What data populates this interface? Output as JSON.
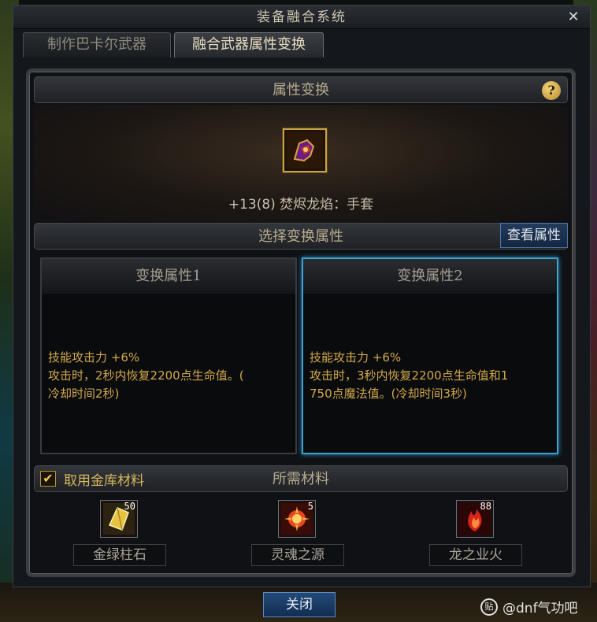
{
  "window": {
    "title": "装备融合系统"
  },
  "tabs": [
    {
      "label": "制作巴卡尔武器",
      "active": false
    },
    {
      "label": "融合武器属性变换",
      "active": true
    }
  ],
  "attribute_section": {
    "title": "属性变换",
    "help": "?"
  },
  "item": {
    "name": "+13(8) 焚烬龙焰：手套",
    "icon": "dragon-gauntlet-icon"
  },
  "select_section": {
    "title": "选择变换属性",
    "view_button": "查看属性"
  },
  "options": [
    {
      "title": "变换属性1",
      "lines": [
        "技能攻击力 +6%",
        "攻击时，2秒内恢复2200点生命值。(",
        "冷却时间2秒)"
      ],
      "selected": false
    },
    {
      "title": "变换属性2",
      "lines": [
        "技能攻击力 +6%",
        "攻击时，3秒内恢复2200点生命值和1",
        "750点魔法值。(冷却时间3秒)"
      ],
      "selected": true
    }
  ],
  "materials_section": {
    "title": "所需材料",
    "checkbox_label": "取用金库材料",
    "checked": true,
    "items": [
      {
        "name": "金绿柱石",
        "qty": "50",
        "icon": "chrysoberyl-icon"
      },
      {
        "name": "灵魂之源",
        "qty": "5",
        "icon": "soul-source-icon"
      },
      {
        "name": "龙之业火",
        "qty": "88",
        "icon": "dragon-fire-icon"
      }
    ]
  },
  "footer": {
    "close_button": "关闭"
  },
  "watermark": {
    "logo": "贴",
    "text": "@dnf气功吧"
  },
  "colors": {
    "accent_blue": "#3aa3d4",
    "gold_text": "#d2a84b",
    "frame": "#3c3e42"
  }
}
